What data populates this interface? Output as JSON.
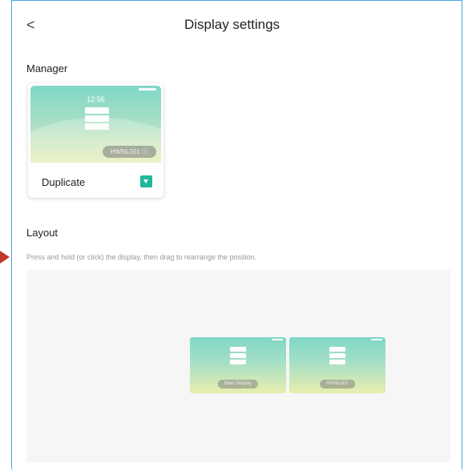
{
  "header": {
    "back_label": "<",
    "title": "Display settings"
  },
  "manager": {
    "label": "Manager",
    "display": {
      "clock": "12:56",
      "pill": "HWNL001 ⓘ",
      "name": "Duplicate"
    }
  },
  "layout": {
    "label": "Layout",
    "hint": "Press and hold (or click) the display, then drag to rearrange the position.",
    "displays": [
      {
        "name": "Main Display"
      },
      {
        "name": "HWNL001"
      }
    ]
  },
  "colors": {
    "accent": "#1fb89a",
    "frame": "#4aa8e0",
    "arrow": "#c0392b"
  }
}
